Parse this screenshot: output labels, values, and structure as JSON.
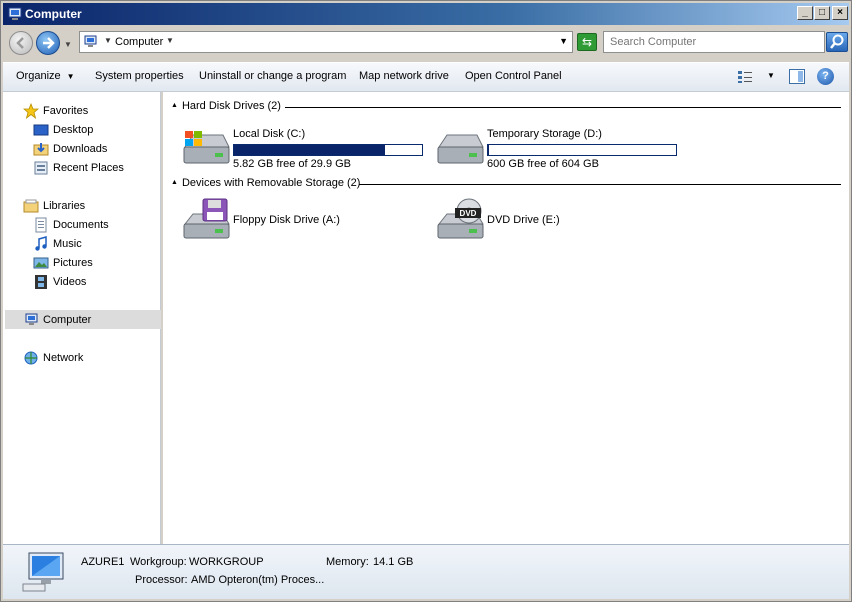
{
  "window": {
    "title": "Computer"
  },
  "address": {
    "crumb": "Computer",
    "search_placeholder": "Search Computer"
  },
  "commands": {
    "organize": "Organize",
    "system_properties": "System properties",
    "uninstall": "Uninstall or change a program",
    "map_network": "Map network drive",
    "control_panel": "Open Control Panel"
  },
  "nav": {
    "favorites": "Favorites",
    "desktop": "Desktop",
    "downloads": "Downloads",
    "recent_places": "Recent Places",
    "libraries": "Libraries",
    "documents": "Documents",
    "music": "Music",
    "pictures": "Pictures",
    "videos": "Videos",
    "computer": "Computer",
    "network": "Network"
  },
  "groups": {
    "hdd": "Hard Disk Drives (2)",
    "removable": "Devices with Removable Storage (2)"
  },
  "drives": [
    {
      "name": "Local Disk (C:)",
      "free_text": "5.82 GB free of 29.9 GB",
      "used_fraction": 0.805
    },
    {
      "name": "Temporary Storage (D:)",
      "free_text": "600 GB free of 604 GB",
      "used_fraction": 0.007
    },
    {
      "name": "Floppy Disk Drive (A:)"
    },
    {
      "name": "DVD Drive (E:)"
    }
  ],
  "dvd_label": "DVD",
  "details": {
    "computer_name": "AZURE1",
    "workgroup_label": "Workgroup:",
    "workgroup": "WORKGROUP",
    "memory_label": "Memory:",
    "memory": "14.1 GB",
    "processor_label": "Processor:",
    "processor": "AMD Opteron(tm) Proces..."
  },
  "colors": {
    "usage_bar": "#0a246a",
    "title_bar": "#0a246a"
  }
}
